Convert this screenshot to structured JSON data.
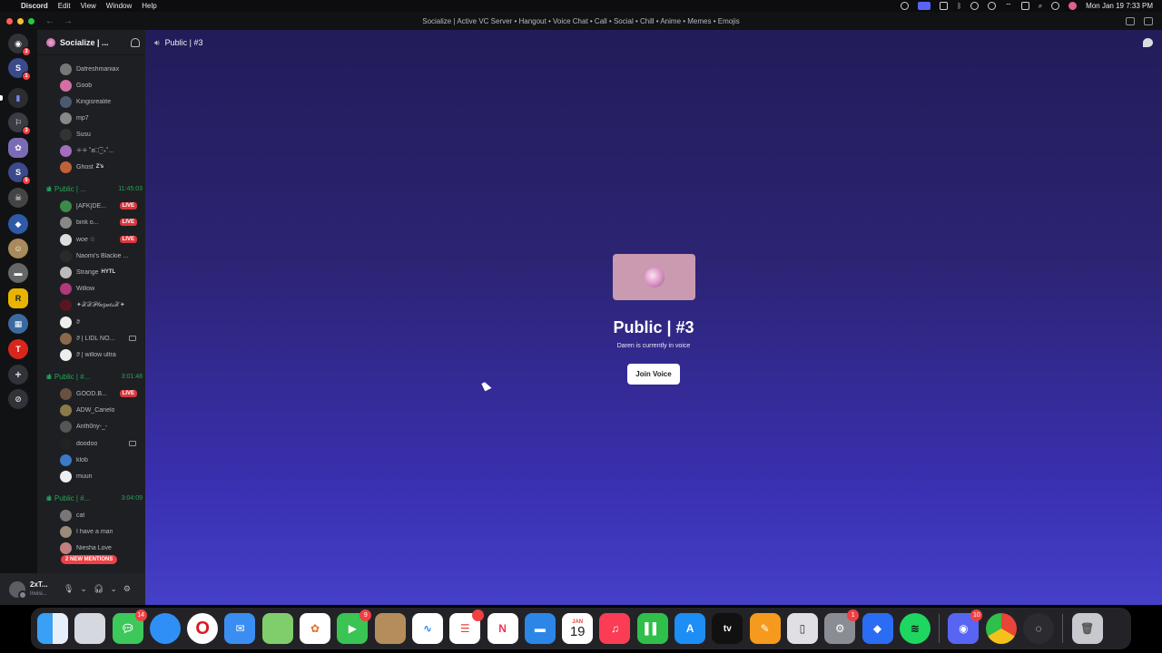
{
  "menubar": {
    "apple": "",
    "app_name": "Discord",
    "items": [
      "Edit",
      "View",
      "Window",
      "Help"
    ],
    "datetime": "Mon Jan 19  7:33 PM"
  },
  "window": {
    "title": "Socialize | Active VC Server • Hangout • Voice Chat • Call • Social • Chill • Anime • Memes • Emojis",
    "back": "←",
    "forward": "→"
  },
  "servers": [
    {
      "badge": "3"
    },
    {
      "badge": "1"
    },
    {
      "badge": ""
    },
    {
      "badge": "3"
    },
    {
      "badge": ""
    },
    {
      "badge": "5"
    },
    {
      "badge": ""
    },
    {
      "badge": ""
    },
    {
      "badge": ""
    },
    {
      "badge": ""
    },
    {
      "badge": ""
    },
    {
      "badge": ""
    },
    {
      "badge": ""
    }
  ],
  "server_name": "Socialize | ...",
  "channels": {
    "group1_members": [
      {
        "name": "Dafreshmaniax",
        "tag": ""
      },
      {
        "name": "Goob",
        "tag": ""
      },
      {
        "name": "Kingisrealite",
        "tag": ""
      },
      {
        "name": "mp7",
        "tag": ""
      },
      {
        "name": "Susu",
        "tag": ""
      },
      {
        "name": "ꔰꔰ ˚ʚ꒰͜͡ ‧₊˚...",
        "tag": ""
      },
      {
        "name": "Ghost",
        "tag": "Z's"
      }
    ],
    "vc2": {
      "name": "Public | ...",
      "time": "11:45:03"
    },
    "group2_members": [
      {
        "name": "[AFK]DE...",
        "live": "LIVE"
      },
      {
        "name": "bink o...",
        "live": "LIVE"
      },
      {
        "name": "woe ☆",
        "live": "LIVE"
      },
      {
        "name": "Naomi's Blackie ...",
        "live": ""
      },
      {
        "name": "Strange",
        "live": "",
        "tag": "HYTL"
      },
      {
        "name": "Willow",
        "live": ""
      },
      {
        "name": "✦𝒳𝒳𝒫𝓁𝒶𝑔𝓊𝑒𝓈𝒳✦",
        "live": ""
      },
      {
        "name": "ϑ",
        "live": ""
      },
      {
        "name": "ϑ | LIDL NO...",
        "live": ""
      },
      {
        "name": "ϑ | willow ultra",
        "live": ""
      }
    ],
    "vc3": {
      "name": "Public | #...",
      "time": "3:01:48"
    },
    "group3_members": [
      {
        "name": "GOOD.B...",
        "live": "LIVE"
      },
      {
        "name": "ADW_Canelo",
        "live": ""
      },
      {
        "name": "Anth0ny-_-",
        "live": ""
      },
      {
        "name": "doodoo",
        "live": ""
      },
      {
        "name": "klob",
        "live": ""
      },
      {
        "name": "muun",
        "live": ""
      }
    ],
    "vc4": {
      "name": "Public | #...",
      "time": "3:04:09"
    },
    "group4_members": [
      {
        "name": "cat"
      },
      {
        "name": "I have a man"
      },
      {
        "name": "Niesha Love"
      }
    ],
    "mentions": "2 NEW MENTIONS"
  },
  "user": {
    "name": "2xT...",
    "status": "Invisi..."
  },
  "main": {
    "channel": "Public | #3",
    "title": "Public | #3",
    "subtitle": "Daren is currently in voice",
    "join_label": "Join Voice"
  },
  "dock": [
    {
      "name": "finder",
      "badge": ""
    },
    {
      "name": "launchpad",
      "badge": ""
    },
    {
      "name": "messages",
      "badge": "14"
    },
    {
      "name": "safari",
      "badge": ""
    },
    {
      "name": "opera",
      "badge": ""
    },
    {
      "name": "mail",
      "badge": ""
    },
    {
      "name": "maps",
      "badge": ""
    },
    {
      "name": "photos",
      "badge": ""
    },
    {
      "name": "facetime",
      "badge": "9"
    },
    {
      "name": "contacts",
      "badge": ""
    },
    {
      "name": "freeform",
      "badge": ""
    },
    {
      "name": "reminders",
      "badge": "2"
    },
    {
      "name": "news",
      "badge": ""
    },
    {
      "name": "keynote",
      "badge": ""
    },
    {
      "name": "calendar",
      "badge": "",
      "month": "JAN",
      "day": "19"
    },
    {
      "name": "music",
      "badge": ""
    },
    {
      "name": "numbers",
      "badge": ""
    },
    {
      "name": "app-store",
      "badge": ""
    },
    {
      "name": "apple-tv",
      "badge": "",
      "label": "tv"
    },
    {
      "name": "pages",
      "badge": ""
    },
    {
      "name": "iphone-mirroring",
      "badge": ""
    },
    {
      "name": "system-settings",
      "badge": "1"
    },
    {
      "name": "roblox",
      "badge": ""
    },
    {
      "name": "spotify",
      "badge": ""
    },
    {
      "name": "discord",
      "badge": "10"
    },
    {
      "name": "chrome",
      "badge": ""
    },
    {
      "name": "obs",
      "badge": ""
    },
    {
      "name": "trash",
      "badge": ""
    }
  ]
}
